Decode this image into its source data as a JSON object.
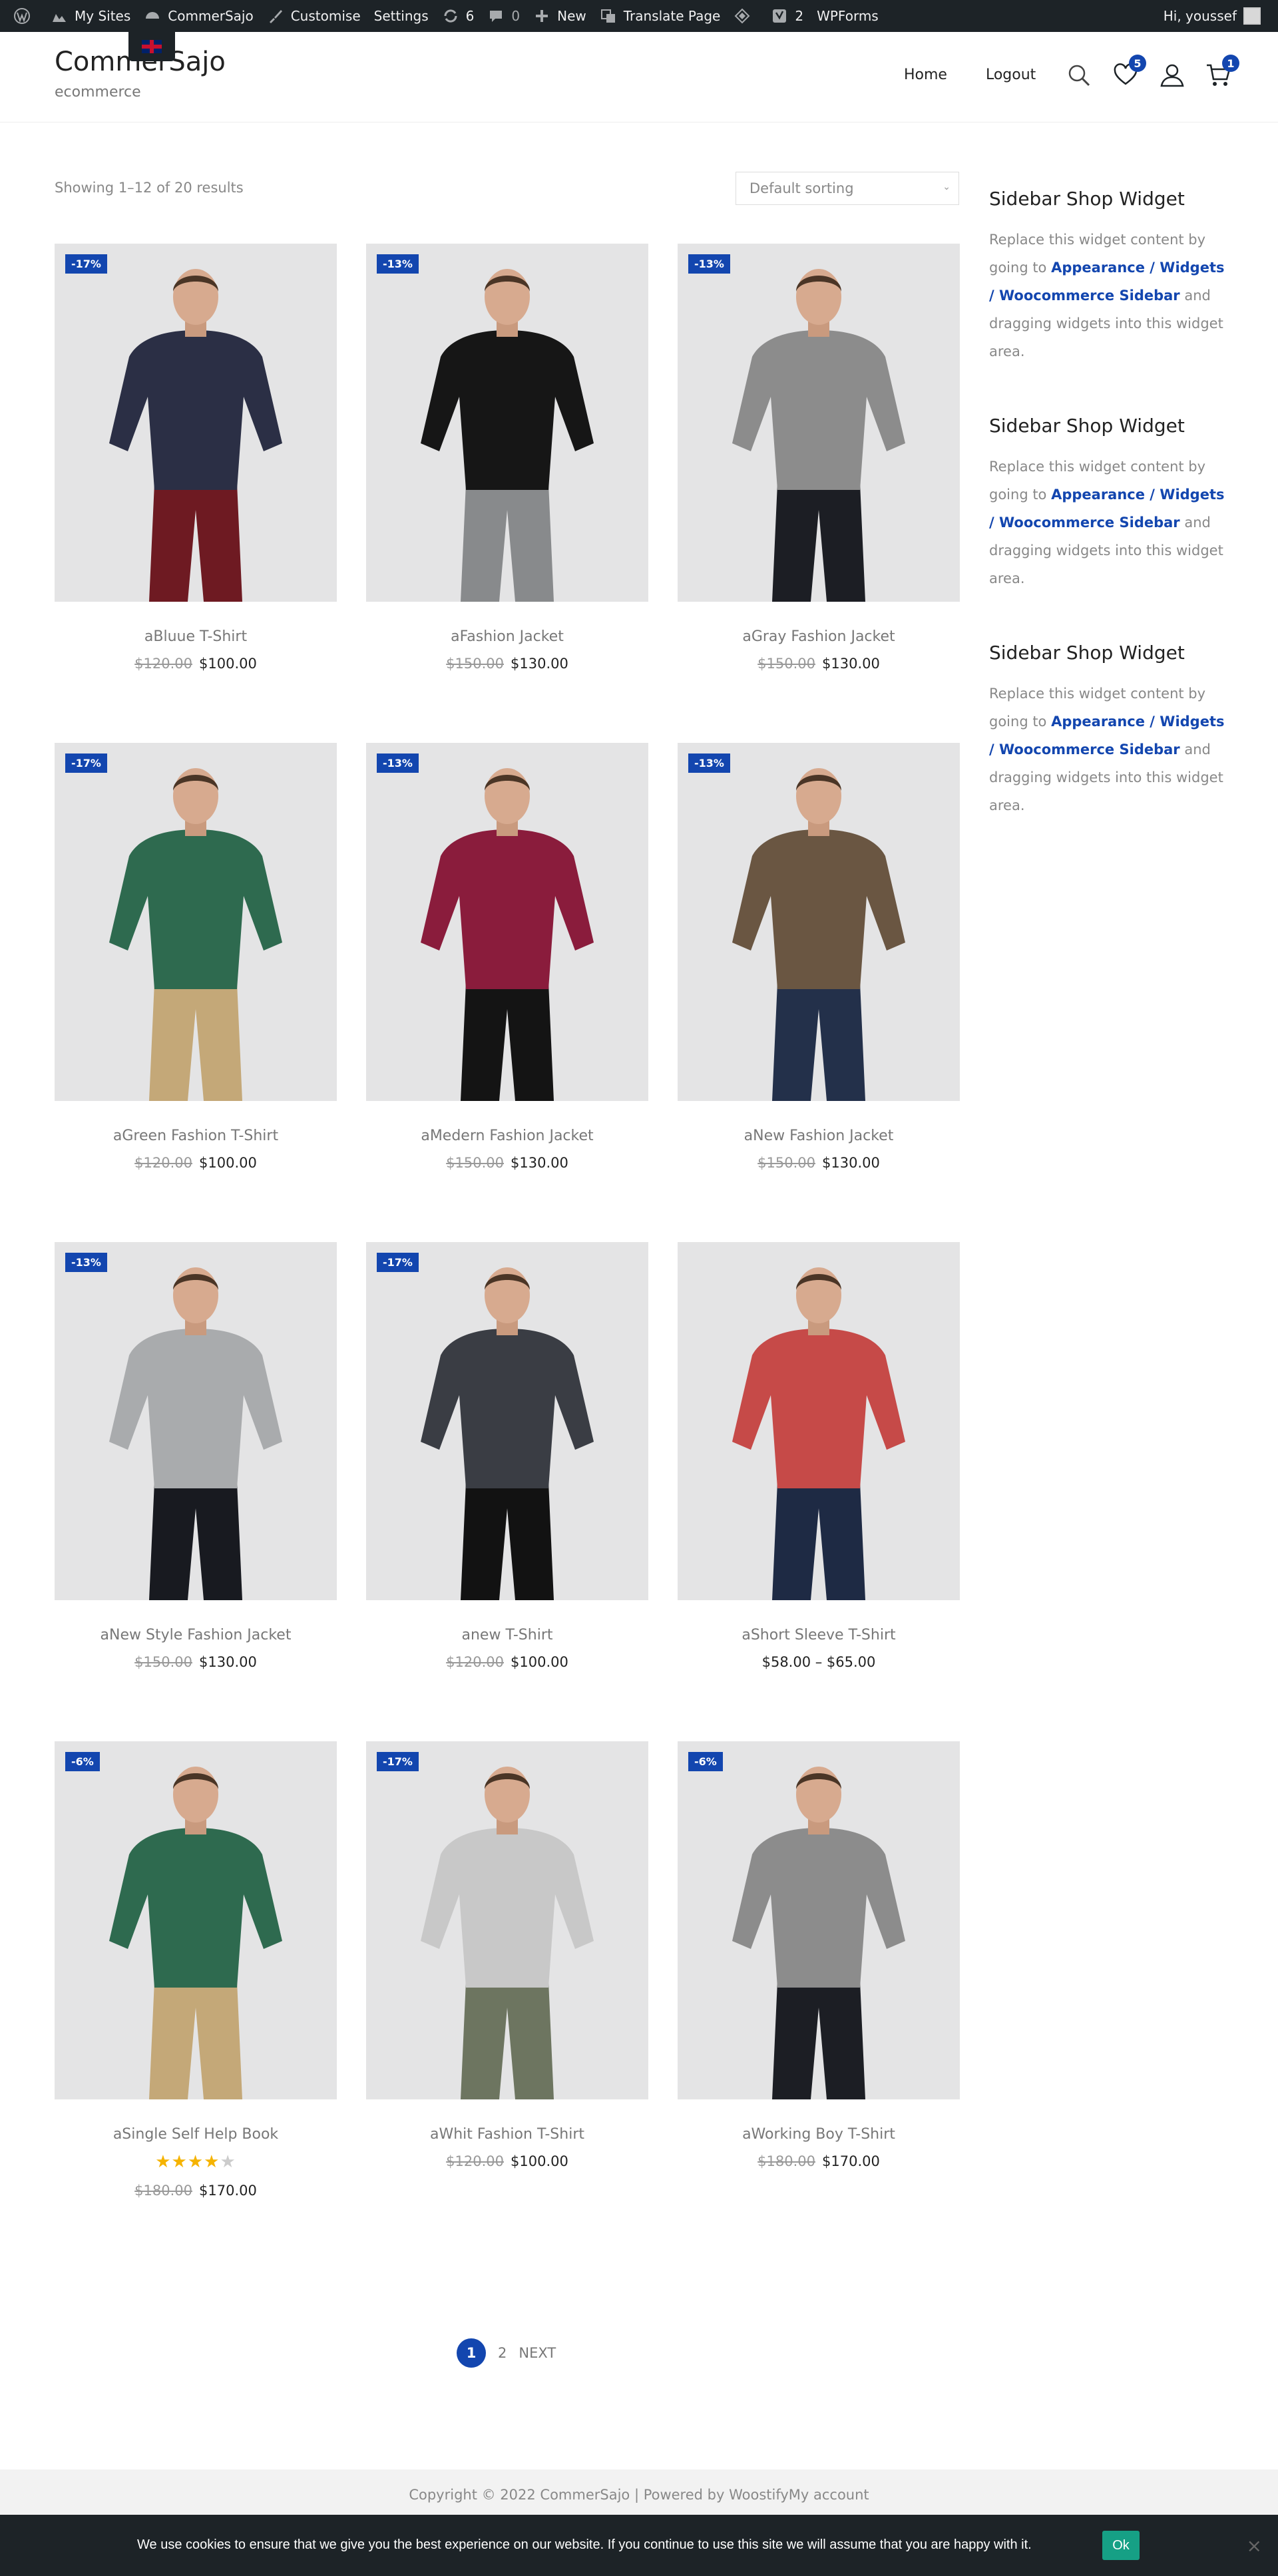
{
  "adminbar": {
    "my_sites": "My Sites",
    "site_name": "CommerSajo",
    "customise": "Customise",
    "settings": "Settings",
    "updates_count": "6",
    "comments_count": "0",
    "new": "New",
    "translate": "Translate Page",
    "yoast_count": "2",
    "wpforms": "WPForms",
    "greeting": "Hi, youssef"
  },
  "header": {
    "site_title": "CommerSajo",
    "tagline": "ecommerce",
    "nav": [
      "Home",
      "Logout"
    ],
    "wishlist_count": "5",
    "cart_count": "1"
  },
  "shop": {
    "result_count": "Showing 1–12 of 20 results",
    "sorting": "Default sorting"
  },
  "colors": {
    "accent": "#1346af",
    "star": "#f5b301",
    "cookie_ok": "#16a085"
  },
  "products": [
    {
      "title": "aBluue T-Shirt",
      "badge": "-17%",
      "old_price": "$120.00",
      "price": "$100.00",
      "top_color": "#2b2f45",
      "bottom_color": "#6e1a22"
    },
    {
      "title": "aFashion Jacket",
      "badge": "-13%",
      "old_price": "$150.00",
      "price": "$130.00",
      "top_color": "#161616",
      "bottom_color": "#888a8c"
    },
    {
      "title": "aGray Fashion Jacket",
      "badge": "-13%",
      "old_price": "$150.00",
      "price": "$130.00",
      "top_color": "#8c8c8c",
      "bottom_color": "#1c1e24"
    },
    {
      "title": "aGreen Fashion T-Shirt",
      "badge": "-17%",
      "old_price": "$120.00",
      "price": "$100.00",
      "top_color": "#2e6a4f",
      "bottom_color": "#c4a878"
    },
    {
      "title": "aMedern Fashion Jacket",
      "badge": "-13%",
      "old_price": "$150.00",
      "price": "$130.00",
      "top_color": "#8a1c3c",
      "bottom_color": "#141414"
    },
    {
      "title": "aNew Fashion Jacket",
      "badge": "-13%",
      "old_price": "$150.00",
      "price": "$130.00",
      "top_color": "#6a5642",
      "bottom_color": "#23304a"
    },
    {
      "title": "aNew Style Fashion Jacket",
      "badge": "-13%",
      "old_price": "$150.00",
      "price": "$130.00",
      "top_color": "#a9abad",
      "bottom_color": "#181a20"
    },
    {
      "title": "anew T-Shirt",
      "badge": "-17%",
      "old_price": "$120.00",
      "price": "$100.00",
      "top_color": "#3a3d44",
      "bottom_color": "#121212"
    },
    {
      "title": "aShort Sleeve T-Shirt",
      "badge": "",
      "old_price": "",
      "price": "$58.00 – $65.00",
      "top_color": "#c64a48",
      "bottom_color": "#1e2a44"
    },
    {
      "title": "aSingle Self Help Book",
      "badge": "-6%",
      "old_price": "$180.00",
      "price": "$170.00",
      "top_color": "#2e6a4f",
      "bottom_color": "#c4a878",
      "rating": 4
    },
    {
      "title": "aWhit Fashion T-Shirt",
      "badge": "-17%",
      "old_price": "$120.00",
      "price": "$100.00",
      "top_color": "#c8c8c8",
      "bottom_color": "#6d7560"
    },
    {
      "title": "aWorking Boy T-Shirt",
      "badge": "-6%",
      "old_price": "$180.00",
      "price": "$170.00",
      "top_color": "#8c8c8c",
      "bottom_color": "#1c1e24"
    }
  ],
  "sidebar": {
    "widgets": [
      {
        "title": "Sidebar Shop Widget",
        "text_before": "Replace this widget content by going to ",
        "link": "Appearance / Widgets / Woocommerce Sidebar",
        "text_after": " and dragging widgets into this widget area."
      },
      {
        "title": "Sidebar Shop Widget",
        "text_before": "Replace this widget content by going to ",
        "link": "Appearance / Widgets / Woocommerce Sidebar",
        "text_after": " and dragging widgets into this widget area."
      },
      {
        "title": "Sidebar Shop Widget",
        "text_before": "Replace this widget content by going to ",
        "link": "Appearance / Widgets / Woocommerce Sidebar",
        "text_after": " and dragging widgets into this widget area."
      }
    ]
  },
  "pagination": {
    "current": "1",
    "page2": "2",
    "next": "NEXT"
  },
  "footer": {
    "copyright": "Copyright © 2022 CommerSajo | Powered by WoostifyMy account"
  },
  "cookie": {
    "text": "We use cookies to ensure that we give you the best experience on our website. If you continue to use this site we will assume that you are happy with it.",
    "ok": "Ok",
    "close": "×"
  }
}
